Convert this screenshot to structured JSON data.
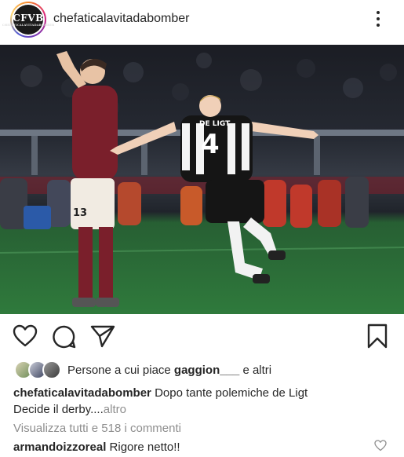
{
  "post": {
    "username": "chefaticalavitadabomber",
    "avatar_monogram": "CFVB",
    "avatar_subtext": "CHEFATICALAVITADABOMBER"
  },
  "likes": {
    "prefix": "Persone a cui piace",
    "user": "gaggion___",
    "suffix": "e altri"
  },
  "caption": {
    "username": "chefaticalavitadabomber",
    "text_line1": "Dopo tante polemiche de Ligt",
    "text_line2": "Decide il derby....",
    "more": "altro"
  },
  "comments": {
    "view_all": "Visualizza tutti e 518 i commenti",
    "first": {
      "username": "armandoizzoreal",
      "text": "Rigore netto!!"
    }
  },
  "photo": {
    "player_name": "DE LIGT",
    "player_number": "4",
    "opponent_number": "13"
  },
  "icons": {
    "like": "heart-icon",
    "comment": "comment-icon",
    "share": "paper-plane-icon",
    "save": "bookmark-icon",
    "more": "more-vertical-icon"
  },
  "colors": {
    "text": "#262626",
    "muted": "#8e8e8e",
    "torino_maroon": "#7a1f2b",
    "pitch_green": "#2f7a3c"
  }
}
